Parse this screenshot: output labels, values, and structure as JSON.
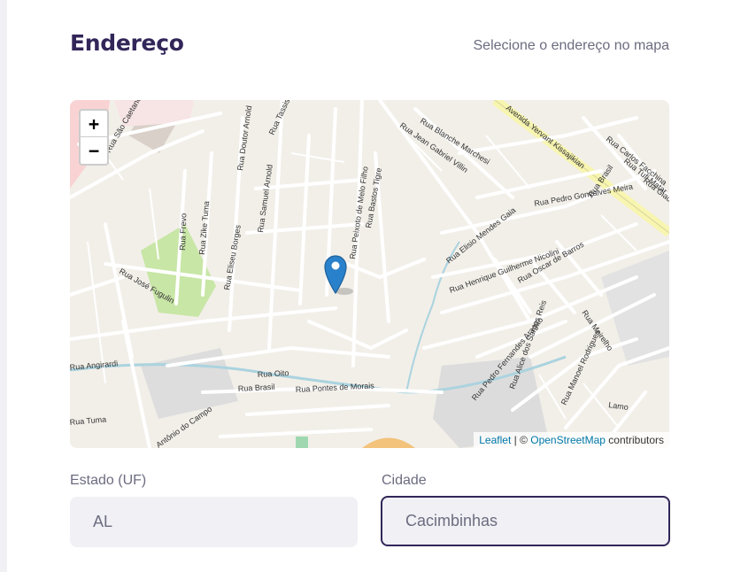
{
  "header": {
    "title": "Endereço",
    "hint": "Selecione o endereço no mapa"
  },
  "map": {
    "zoom_in_label": "+",
    "zoom_out_label": "−",
    "attribution": {
      "leaflet": "Leaflet",
      "separator": " | © ",
      "osm": "OpenStreetMap",
      "suffix": " contributors"
    },
    "marker_icon": "map-pin-icon",
    "marker_color": "#2a81cb",
    "street_labels": [
      "Rua São Caetano",
      "Rua Doutor Arnold",
      "Rua Samuel Arnold",
      "Rua Tassis",
      "Rua Frevo",
      "Rua Zike Tuma",
      "Rua Eliseu Borges",
      "Rua José Fugulin",
      "Rua Peixoto de Melo Filho",
      "Rua Bastos Tigre",
      "Rua Blanche Marchesi",
      "Rua Jean Gabriel Villin",
      "Avenida Yervant Kissajikian",
      "Rua Carlos Facchina",
      "Rua Tufi Matar",
      "Rua Giacomo",
      "Rua Brasil",
      "Rua Pedro Gonçalves Meira",
      "Rua Elisio Mendes Gaia",
      "Rua Henrique Guilherme Nicolini",
      "Rua Oscar de Barros",
      "Rua Oito",
      "Rua Brasil",
      "Rua Pontes de Morais",
      "Rua Pedro Fernandes Aragão",
      "Rua Alice dos Santos Reis",
      "Rua Manoel Rodrigues",
      "Rua Meirelho",
      "Rua Tuma",
      "Antônio do Campo",
      "Rua Angirardi",
      "Lamo"
    ]
  },
  "form": {
    "state_label": "Estado (UF)",
    "state_value": "AL",
    "city_label": "Cidade",
    "city_value": "Cacimbinhas"
  }
}
